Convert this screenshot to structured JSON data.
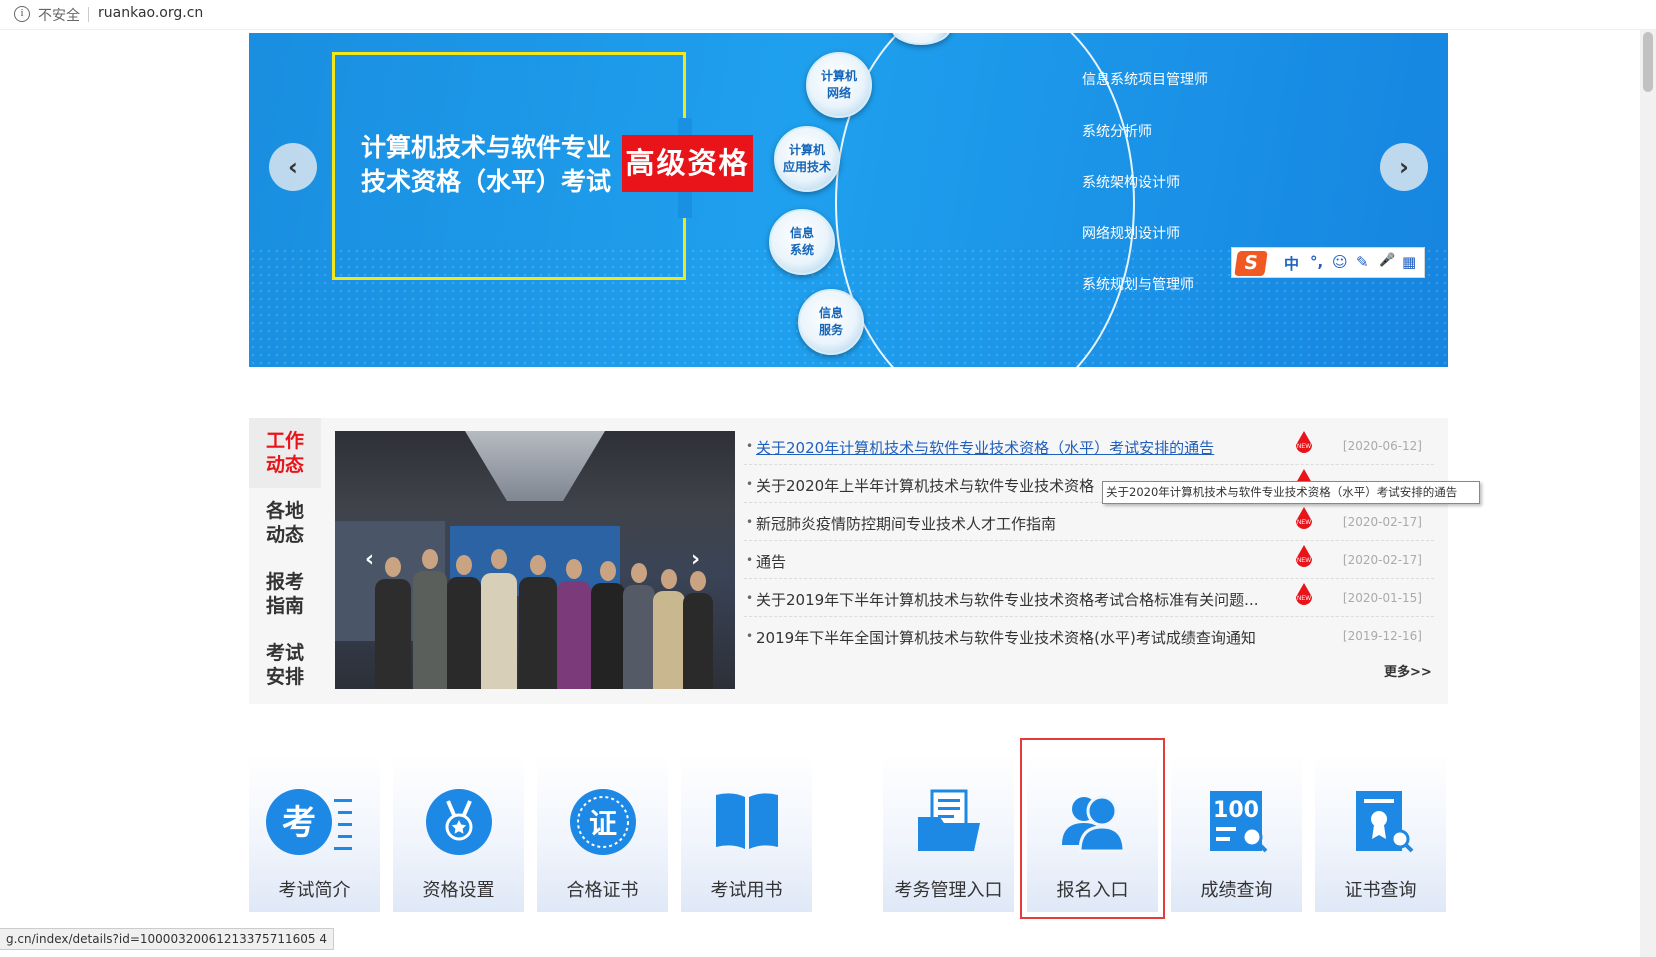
{
  "browser": {
    "security_label": "不安全",
    "url": "ruankao.org.cn",
    "status_url": "g.cn/index/details?id=10000320061213375711605 4",
    "info_icon": "info-icon"
  },
  "banner": {
    "title_line1": "计算机技术与软件专业",
    "title_line2": "技术资格（水平）考试",
    "level_tag": "高级资格",
    "nodes": [
      {
        "line1": "计算机",
        "line2": "网络"
      },
      {
        "line1": "计算机",
        "line2": "应用技术"
      },
      {
        "line1": "信息",
        "line2": "系统"
      },
      {
        "line1": "信息",
        "line2": "服务"
      }
    ],
    "positions": [
      "信息系统项目管理师",
      "系统分析师",
      "系统架构设计师",
      "网络规划设计师",
      "系统规划与管理师"
    ],
    "prev_icon": "chevron-left-icon",
    "next_icon": "chevron-right-icon"
  },
  "ime": {
    "logo": "S",
    "items": [
      "中",
      "°,",
      "☺",
      "✎",
      "🎤",
      "▦"
    ]
  },
  "news": {
    "tabs": [
      {
        "label": "工作动态",
        "active": true
      },
      {
        "label": "各地动态",
        "active": false
      },
      {
        "label": "报考指南",
        "active": false
      },
      {
        "label": "考试安排",
        "active": false
      }
    ],
    "items": [
      {
        "title": "关于2020年计算机技术与软件专业技术资格（水平）考试安排的通告",
        "date": "[2020-06-12]",
        "is_new": true
      },
      {
        "title": "关于2020年上半年计算机技术与软件专业技术资格",
        "date": "",
        "is_new": true
      },
      {
        "title": "新冠肺炎疫情防控期间专业技术人才工作指南",
        "date": "[2020-02-17]",
        "is_new": true
      },
      {
        "title": "通告",
        "date": "[2020-02-17]",
        "is_new": true
      },
      {
        "title": "关于2019年下半年计算机技术与软件专业技术资格考试合格标准有关问题...",
        "date": "[2020-01-15]",
        "is_new": true
      },
      {
        "title": "2019年下半年全国计算机技术与软件专业技术资格(水平)考试成绩查询通知",
        "date": "[2019-12-16]",
        "is_new": false
      }
    ],
    "more": "更多>>",
    "tooltip": "关于2020年计算机技术与软件专业技术资格（水平）考试安排的通告"
  },
  "tiles": [
    {
      "label": "考试简介",
      "icon": "exam-icon"
    },
    {
      "label": "资格设置",
      "icon": "medal-icon"
    },
    {
      "label": "合格证书",
      "icon": "certificate-seal-icon"
    },
    {
      "label": "考试用书",
      "icon": "book-icon"
    },
    {
      "label": "考务管理入口",
      "icon": "folder-document-icon"
    },
    {
      "label": "报名入口",
      "icon": "users-icon"
    },
    {
      "label": "成绩查询",
      "icon": "score-search-icon"
    },
    {
      "label": "证书查询",
      "icon": "certificate-search-icon"
    }
  ],
  "colors": {
    "brand_blue": "#1e88e5",
    "accent_red": "#e8141a",
    "highlight_red": "#e53b3b"
  }
}
